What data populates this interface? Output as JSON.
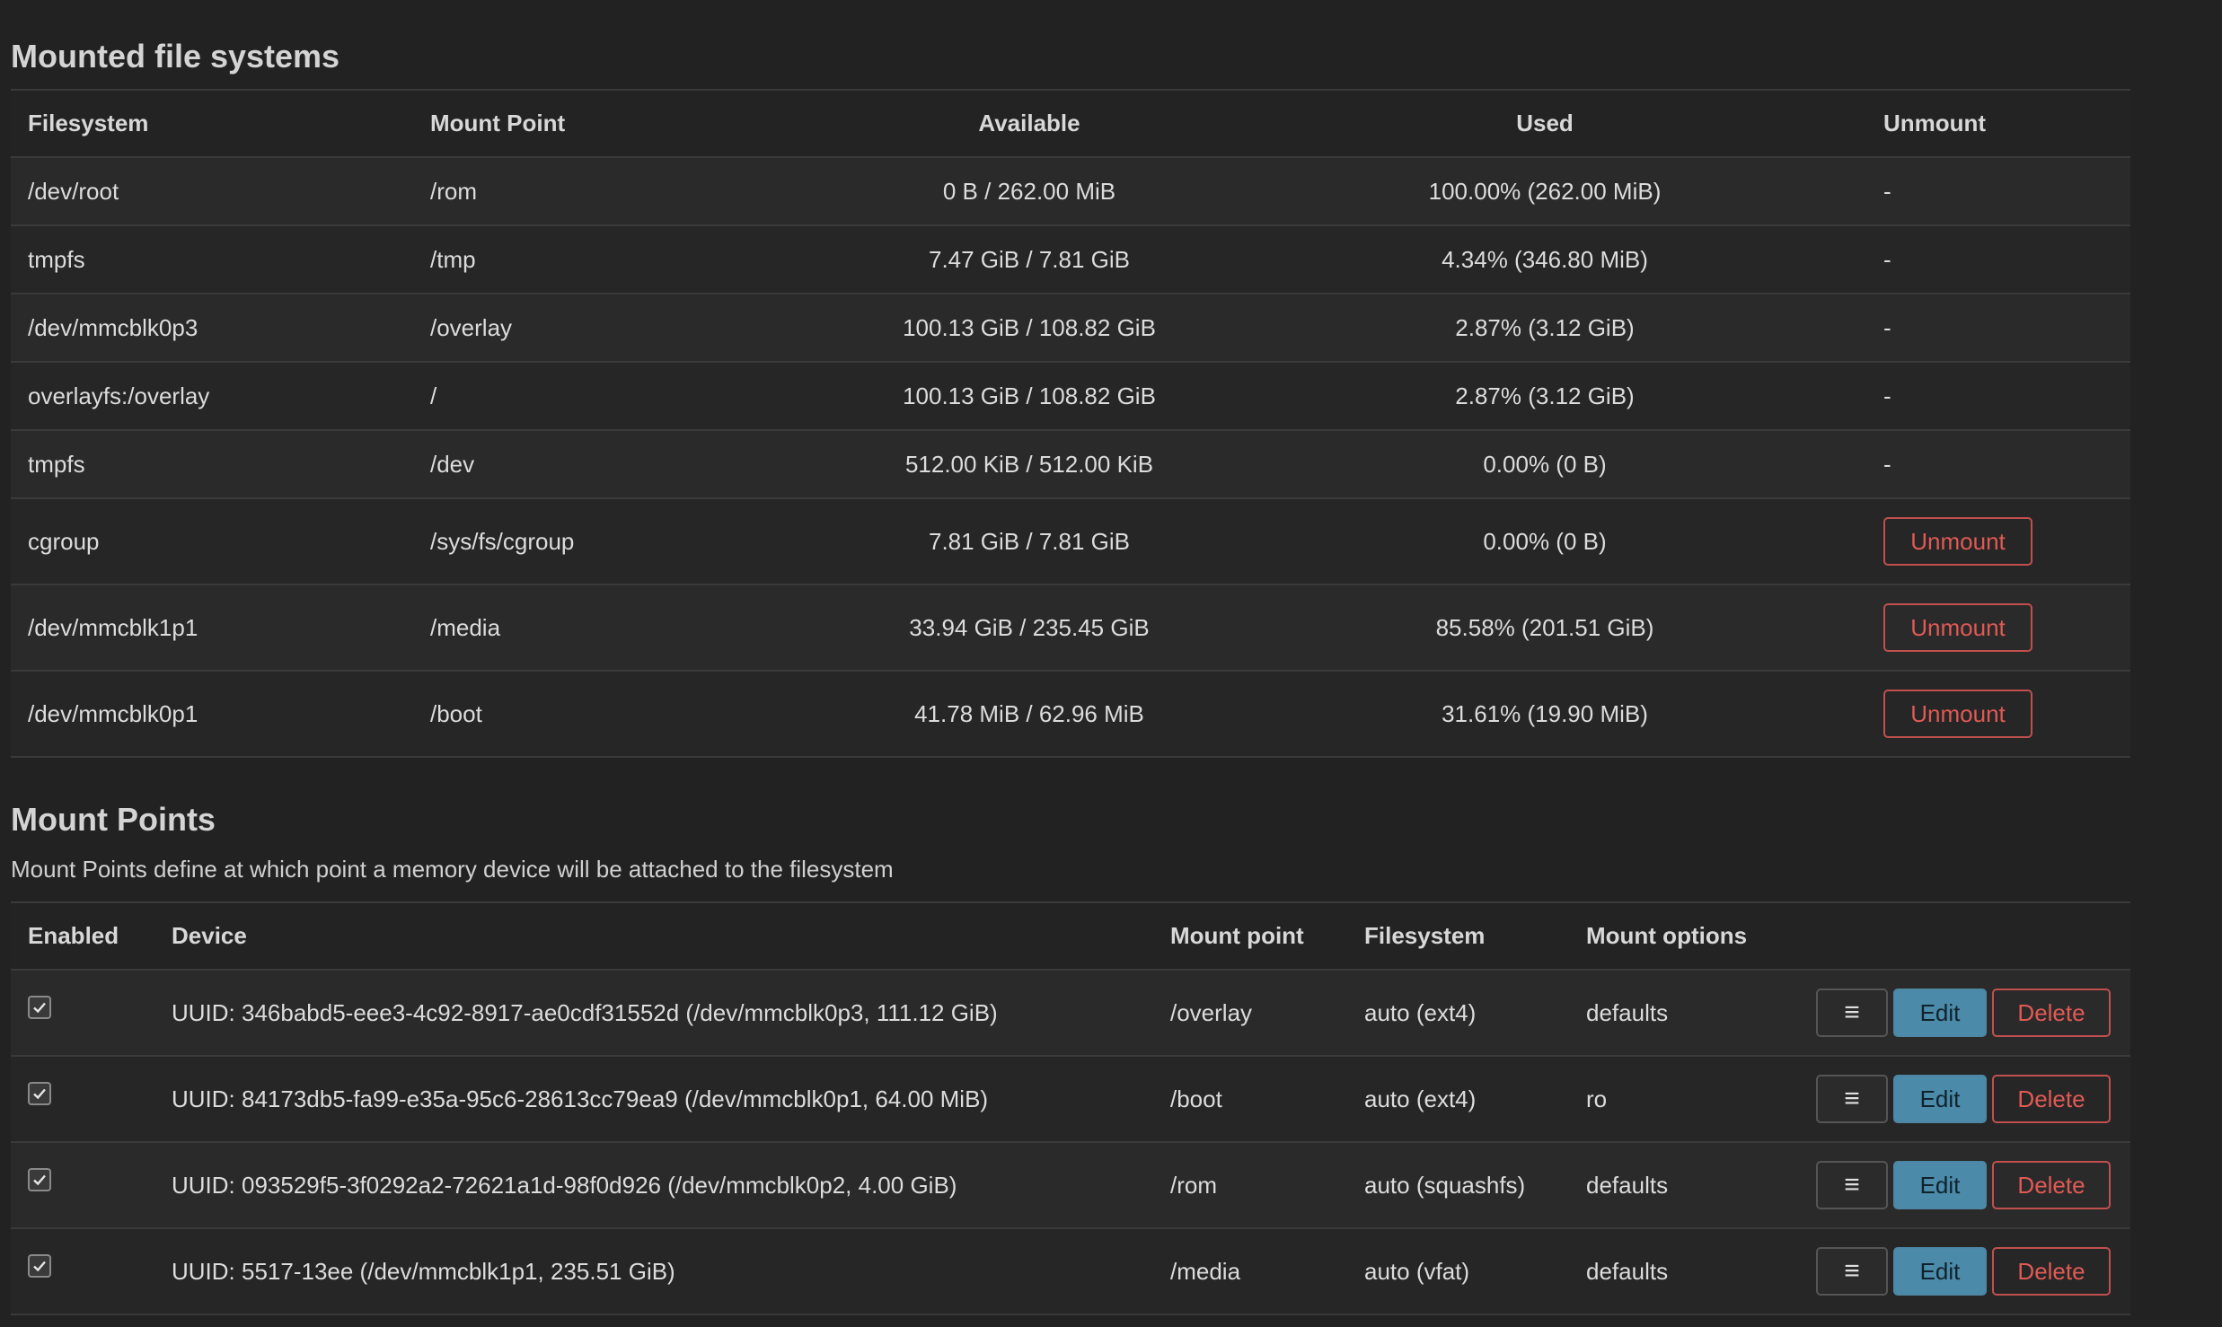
{
  "mounted": {
    "title": "Mounted file systems",
    "headers": [
      "Filesystem",
      "Mount Point",
      "Available",
      "Used",
      "Unmount"
    ],
    "rows": [
      {
        "filesystem": "/dev/root",
        "mount": "/rom",
        "available": "0 B / 262.00 MiB",
        "used": "100.00% (262.00 MiB)",
        "unmount": "-"
      },
      {
        "filesystem": "tmpfs",
        "mount": "/tmp",
        "available": "7.47 GiB / 7.81 GiB",
        "used": "4.34% (346.80 MiB)",
        "unmount": "-"
      },
      {
        "filesystem": "/dev/mmcblk0p3",
        "mount": "/overlay",
        "available": "100.13 GiB / 108.82 GiB",
        "used": "2.87% (3.12 GiB)",
        "unmount": "-"
      },
      {
        "filesystem": "overlayfs:/overlay",
        "mount": "/",
        "available": "100.13 GiB / 108.82 GiB",
        "used": "2.87% (3.12 GiB)",
        "unmount": "-"
      },
      {
        "filesystem": "tmpfs",
        "mount": "/dev",
        "available": "512.00 KiB / 512.00 KiB",
        "used": "0.00% (0 B)",
        "unmount": "-"
      },
      {
        "filesystem": "cgroup",
        "mount": "/sys/fs/cgroup",
        "available": "7.81 GiB / 7.81 GiB",
        "used": "0.00% (0 B)",
        "unmount": "Unmount"
      },
      {
        "filesystem": "/dev/mmcblk1p1",
        "mount": "/media",
        "available": "33.94 GiB / 235.45 GiB",
        "used": "85.58% (201.51 GiB)",
        "unmount": "Unmount"
      },
      {
        "filesystem": "/dev/mmcblk0p1",
        "mount": "/boot",
        "available": "41.78 MiB / 62.96 MiB",
        "used": "31.61% (19.90 MiB)",
        "unmount": "Unmount"
      }
    ]
  },
  "mountpoints": {
    "title": "Mount Points",
    "description": "Mount Points define at which point a memory device will be attached to the filesystem",
    "headers": [
      "Enabled",
      "Device",
      "Mount point",
      "Filesystem",
      "Mount options"
    ],
    "menu_label": "≡",
    "edit_label": "Edit",
    "delete_label": "Delete",
    "rows": [
      {
        "enabled": true,
        "device": "UUID: 346babd5-eee3-4c92-8917-ae0cdf31552d (/dev/mmcblk0p3, 111.12 GiB)",
        "mount": "/overlay",
        "filesystem": "auto (ext4)",
        "options": "defaults"
      },
      {
        "enabled": true,
        "device": "UUID: 84173db5-fa99-e35a-95c6-28613cc79ea9 (/dev/mmcblk0p1, 64.00 MiB)",
        "mount": "/boot",
        "filesystem": "auto (ext4)",
        "options": "ro"
      },
      {
        "enabled": true,
        "device": "UUID: 093529f5-3f0292a2-72621a1d-98f0d926 (/dev/mmcblk0p2, 4.00 GiB)",
        "mount": "/rom",
        "filesystem": "auto (squashfs)",
        "options": "defaults"
      },
      {
        "enabled": true,
        "device": "UUID: 5517-13ee (/dev/mmcblk1p1, 235.51 GiB)",
        "mount": "/media",
        "filesystem": "auto (vfat)",
        "options": "defaults"
      }
    ]
  },
  "colors": {
    "background": "#222222",
    "danger": "#e05a55",
    "primary": "#4b8aa8"
  }
}
